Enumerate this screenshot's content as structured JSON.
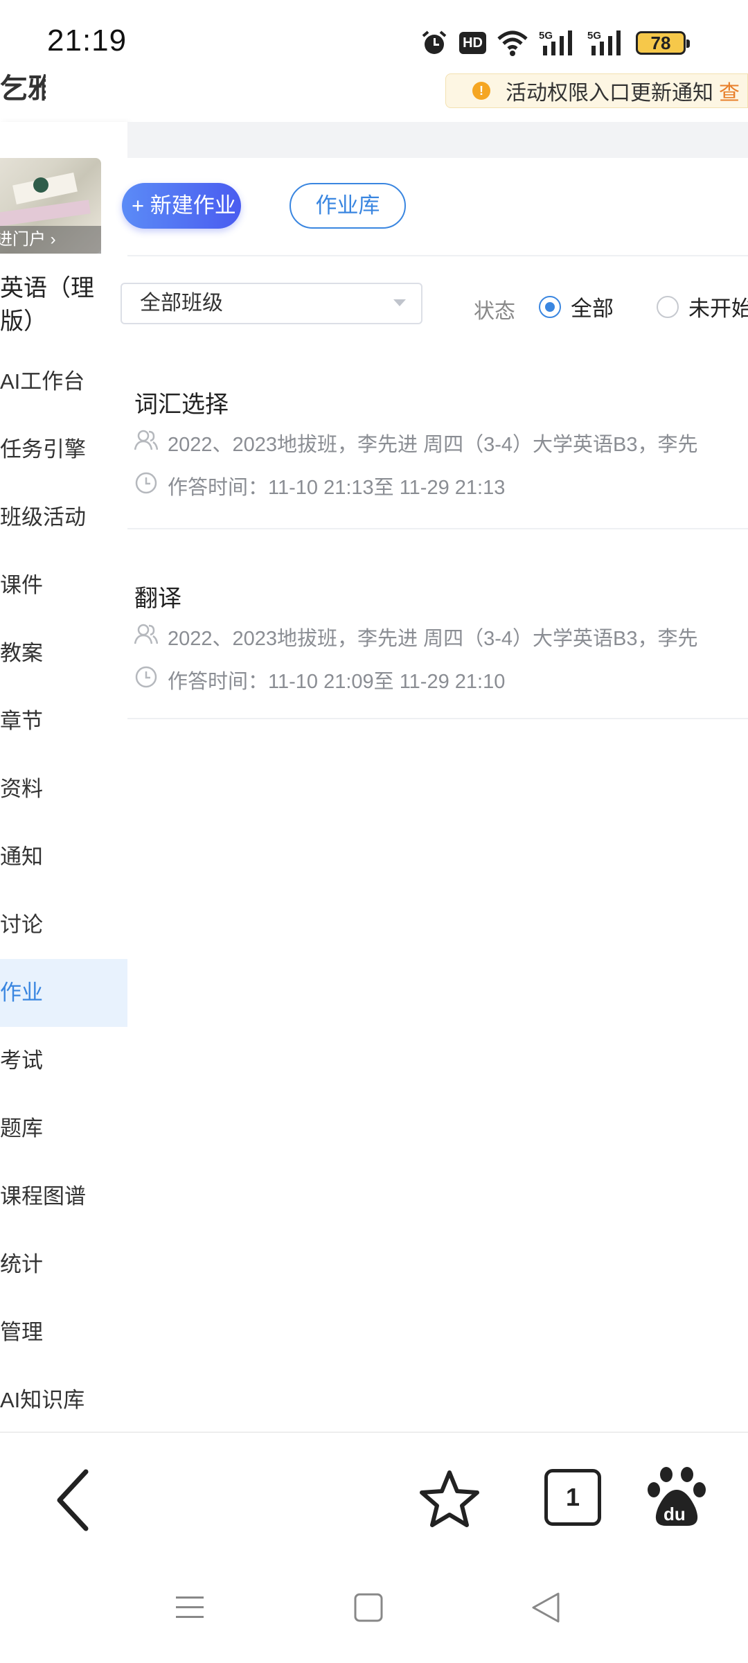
{
  "status_bar": {
    "time": "21:19",
    "hd_label": "HD",
    "network_1": "5G",
    "network_2": "5G",
    "battery": "78",
    "icons": [
      "alarm-icon",
      "hd-icon",
      "wifi-icon",
      "signal-5g-icon",
      "signal-5g-icon",
      "battery-icon"
    ]
  },
  "header": {
    "brand": "乞雅",
    "notice_text": "活动权限入口更新通知",
    "notice_link": "查"
  },
  "sidebar": {
    "portal_tag": "进门户 ›",
    "course_title": "英语（理版）",
    "items": [
      {
        "label": "AI工作台"
      },
      {
        "label": "任务引擎"
      },
      {
        "label": "班级活动"
      },
      {
        "label": "课件"
      },
      {
        "label": "教案"
      },
      {
        "label": "章节"
      },
      {
        "label": "资料"
      },
      {
        "label": "通知"
      },
      {
        "label": "讨论"
      },
      {
        "label": "作业"
      },
      {
        "label": "考试"
      },
      {
        "label": "题库"
      },
      {
        "label": "课程图谱"
      },
      {
        "label": "统计"
      },
      {
        "label": "管理"
      },
      {
        "label": "AI知识库"
      }
    ],
    "active_item": "作业"
  },
  "main": {
    "new_button": "+ 新建作业",
    "library_button": "作业库",
    "class_select": "全部班级",
    "status_label": "状态",
    "radio_all": "全部",
    "radio_not_started": "未开始",
    "tasks": [
      {
        "title": "词汇选择",
        "classes": "2022、2023地拔班，李先进 周四（3-4）大学英语B3，李先",
        "time": "作答时间：11-10 21:13至 11-29 21:13"
      },
      {
        "title": "翻译",
        "classes": "2022、2023地拔班，李先进 周四（3-4）大学英语B3，李先",
        "time": "作答时间：11-10 21:09至 11-29 21:10"
      }
    ]
  },
  "browser_bar": {
    "tab_count": "1",
    "icons": [
      "back-arrow-icon",
      "star-icon",
      "tabs-icon",
      "baidu-paw-icon"
    ]
  },
  "system_nav": {
    "icons": [
      "menu-icon",
      "home-square-icon",
      "back-triangle-icon"
    ]
  },
  "colors": {
    "accent": "#3a86e0",
    "new_button_start": "#5b8bf6",
    "new_button_end": "#4a5cf0",
    "notice_bg": "#fdf6e3",
    "notice_link": "#e87f2a",
    "battery": "#f6c84a"
  }
}
